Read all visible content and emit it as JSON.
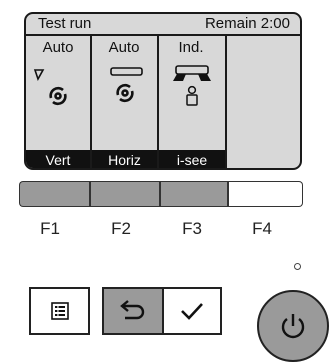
{
  "status": {
    "title": "Test run",
    "remain": "Remain 2:00"
  },
  "columns": [
    {
      "heading": "Auto",
      "function_label": "Vert"
    },
    {
      "heading": "Auto",
      "function_label": "Horiz"
    },
    {
      "heading": "Ind.",
      "function_label": "i-see"
    }
  ],
  "fkeys": [
    {
      "label": "F1"
    },
    {
      "label": "F2"
    },
    {
      "label": "F3"
    },
    {
      "label": "F4"
    }
  ],
  "icons": {
    "vane_vertical": "vertical-vane-icon",
    "fan_swing": "fan-swirl-icon",
    "vane_horizontal": "horizontal-vane-icon",
    "indoor_unit": "indoor-unit-icon",
    "person": "person-sensor-icon",
    "menu": "menu-icon",
    "back": "return-arrow-icon",
    "confirm": "checkmark-icon",
    "power": "power-icon"
  },
  "colors": {
    "lcd_bg": "#d8d8d8",
    "button_gray": "#9a9a9a",
    "outline": "#1a1a1a"
  }
}
